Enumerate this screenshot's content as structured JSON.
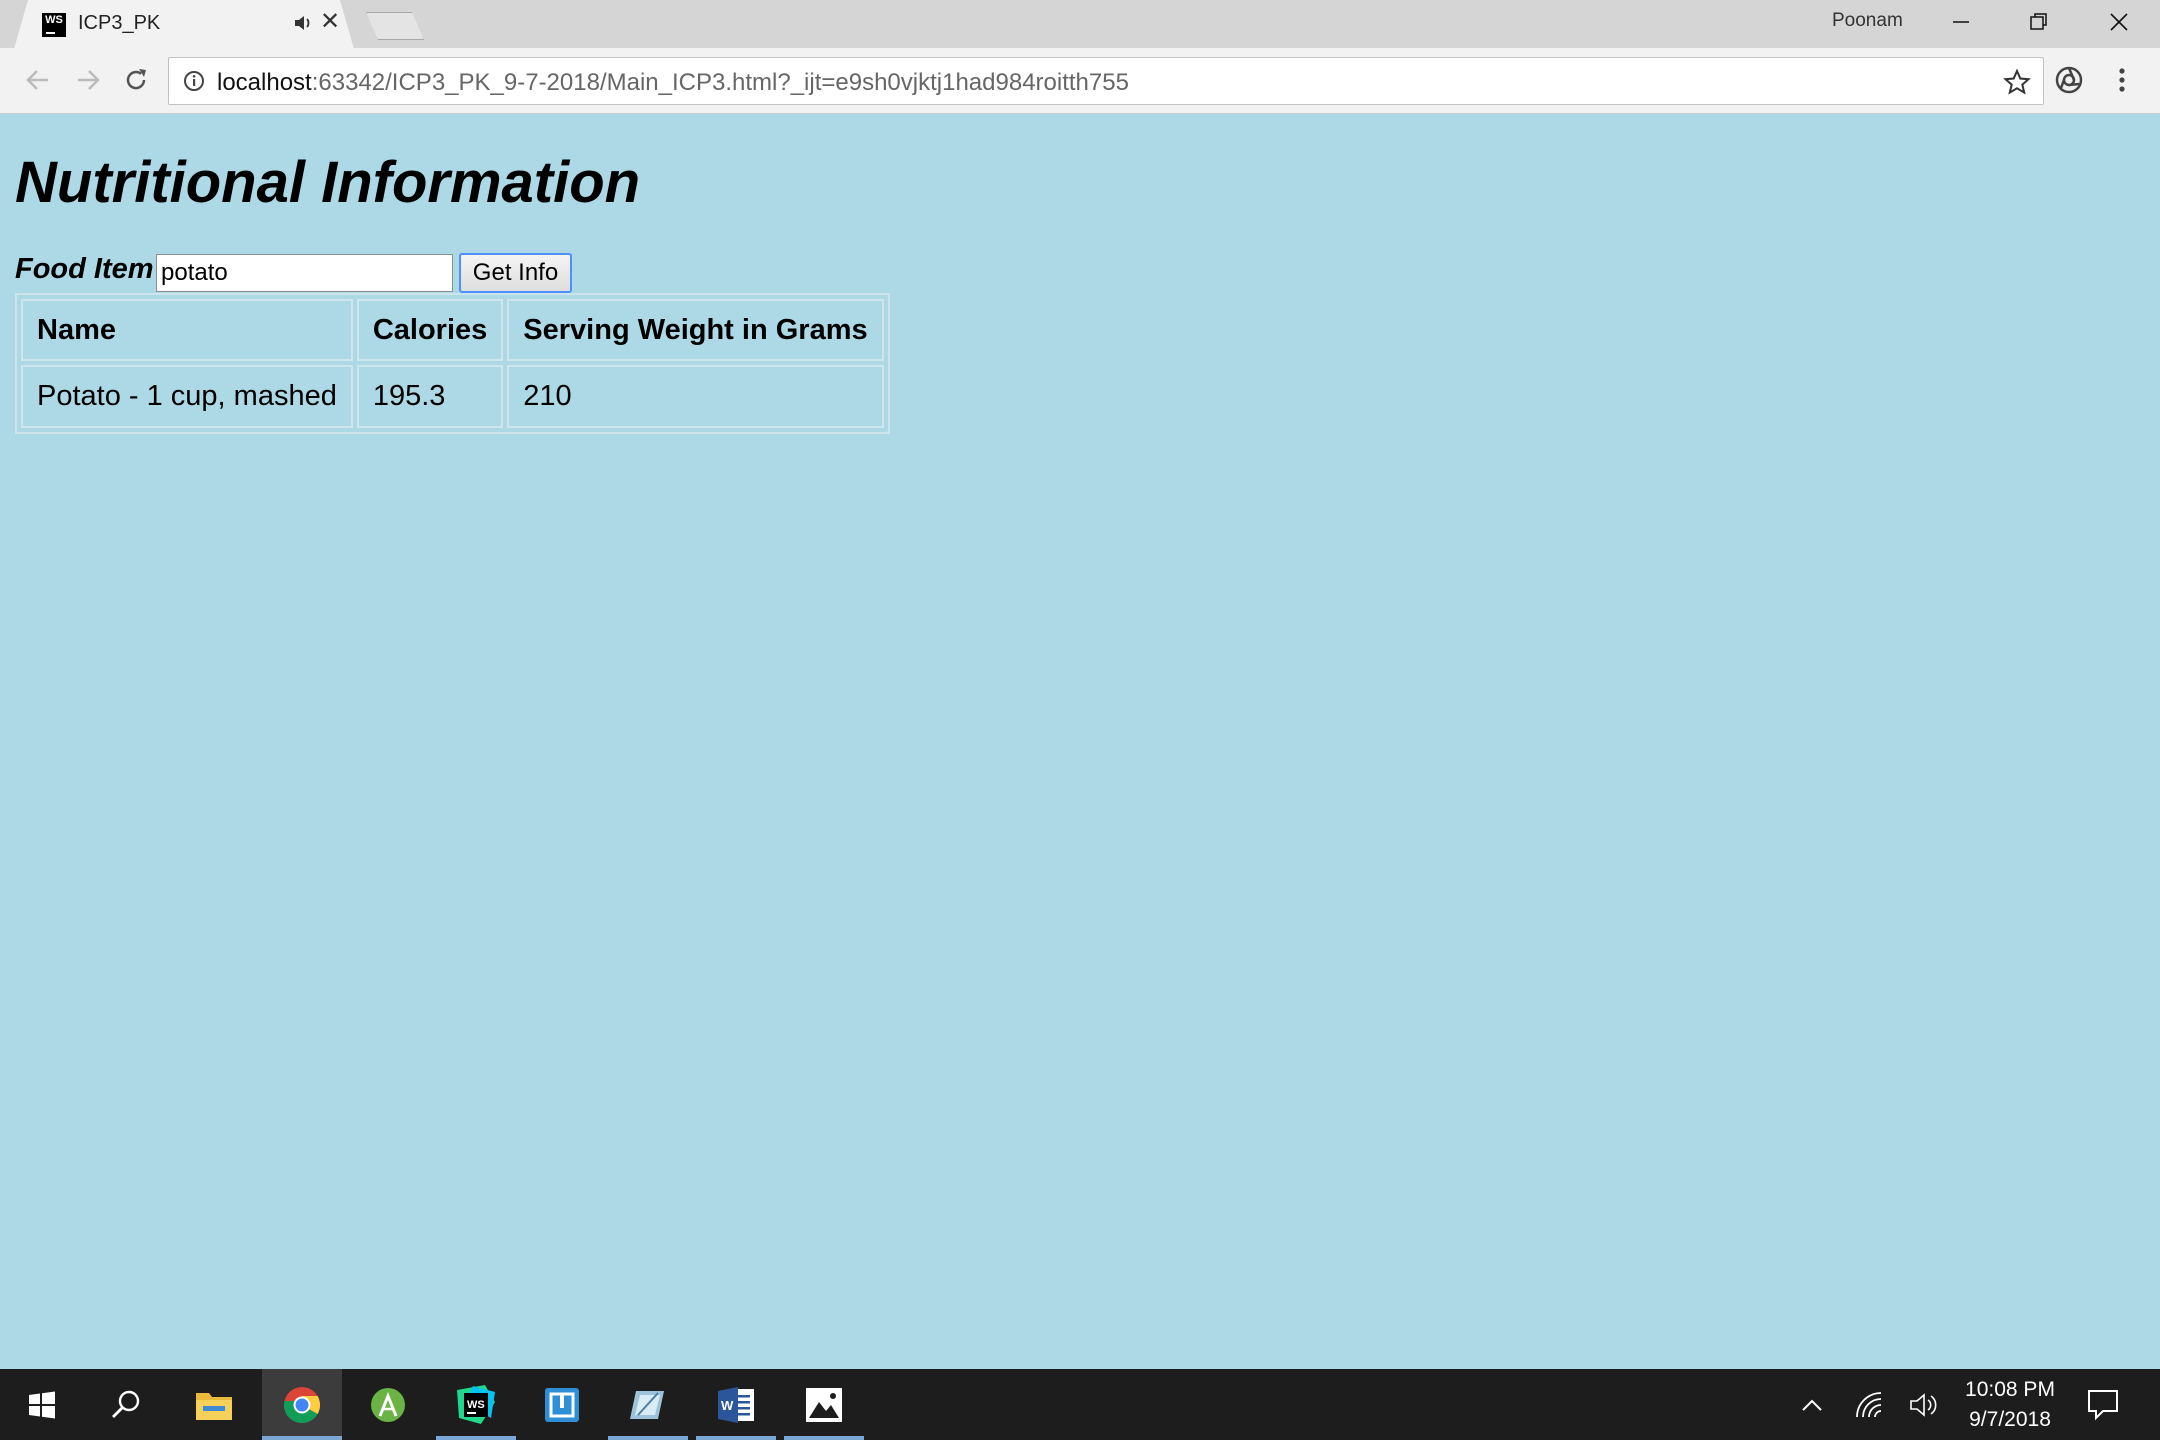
{
  "browser": {
    "tab_title": "ICP3_PK",
    "tab_favicon_text": "WS",
    "profile_name": "Poonam",
    "url_host": "localhost",
    "url_rest": ":63342/ICP3_PK_9-7-2018/Main_ICP3.html?_ijt=e9sh0vjktj1had984roitth755"
  },
  "page": {
    "title": "Nutritional Information",
    "food_label": "Food Item",
    "food_input_value": "potato",
    "get_info_label": "Get Info",
    "table": {
      "headers": [
        "Name",
        "Calories",
        "Serving Weight in Grams"
      ],
      "rows": [
        [
          "Potato - 1 cup, mashed",
          "195.3",
          "210"
        ]
      ]
    }
  },
  "taskbar": {
    "apps": [
      "start",
      "search",
      "file-explorer",
      "chrome",
      "android-studio",
      "webstorm",
      "app-blue",
      "paint-app",
      "word",
      "photos"
    ],
    "time": "10:08 PM",
    "date": "9/7/2018"
  },
  "colors": {
    "page_background": "#add8e6",
    "taskbar": "#1d1d1d",
    "button_focus": "#4d90fe"
  }
}
